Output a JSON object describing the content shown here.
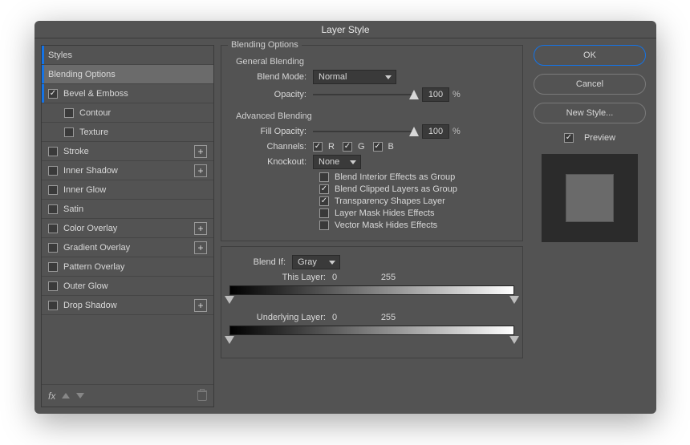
{
  "title": "Layer Style",
  "sidebar": {
    "styles_label": "Styles",
    "blending_options_label": "Blending Options",
    "items": [
      {
        "label": "Bevel & Emboss",
        "checked": true,
        "plus": false
      },
      {
        "label": "Contour",
        "checked": false,
        "sub": true
      },
      {
        "label": "Texture",
        "checked": false,
        "sub": true
      },
      {
        "label": "Stroke",
        "checked": false,
        "plus": true
      },
      {
        "label": "Inner Shadow",
        "checked": false,
        "plus": true
      },
      {
        "label": "Inner Glow",
        "checked": false
      },
      {
        "label": "Satin",
        "checked": false
      },
      {
        "label": "Color Overlay",
        "checked": false,
        "plus": true
      },
      {
        "label": "Gradient Overlay",
        "checked": false,
        "plus": true
      },
      {
        "label": "Pattern Overlay",
        "checked": false
      },
      {
        "label": "Outer Glow",
        "checked": false
      },
      {
        "label": "Drop Shadow",
        "checked": false,
        "plus": true
      }
    ],
    "fx_label": "fx"
  },
  "main": {
    "group_label": "Blending Options",
    "general": {
      "heading": "General Blending",
      "blend_mode_label": "Blend Mode:",
      "blend_mode_value": "Normal",
      "opacity_label": "Opacity:",
      "opacity_value": "100",
      "percent": "%"
    },
    "advanced": {
      "heading": "Advanced Blending",
      "fill_opacity_label": "Fill Opacity:",
      "fill_opacity_value": "100",
      "percent": "%",
      "channels_label": "Channels:",
      "ch_r": "R",
      "ch_g": "G",
      "ch_b": "B",
      "knockout_label": "Knockout:",
      "knockout_value": "None",
      "opt_interior": "Blend Interior Effects as Group",
      "opt_clipped": "Blend Clipped Layers as Group",
      "opt_transparency": "Transparency Shapes Layer",
      "opt_layer_mask": "Layer Mask Hides Effects",
      "opt_vector_mask": "Vector Mask Hides Effects"
    },
    "blend_if": {
      "label": "Blend If:",
      "value": "Gray",
      "this_layer_label": "This Layer:",
      "this_layer_low": "0",
      "this_layer_high": "255",
      "underlying_label": "Underlying Layer:",
      "underlying_low": "0",
      "underlying_high": "255"
    }
  },
  "right": {
    "ok": "OK",
    "cancel": "Cancel",
    "new_style": "New Style...",
    "preview": "Preview"
  }
}
